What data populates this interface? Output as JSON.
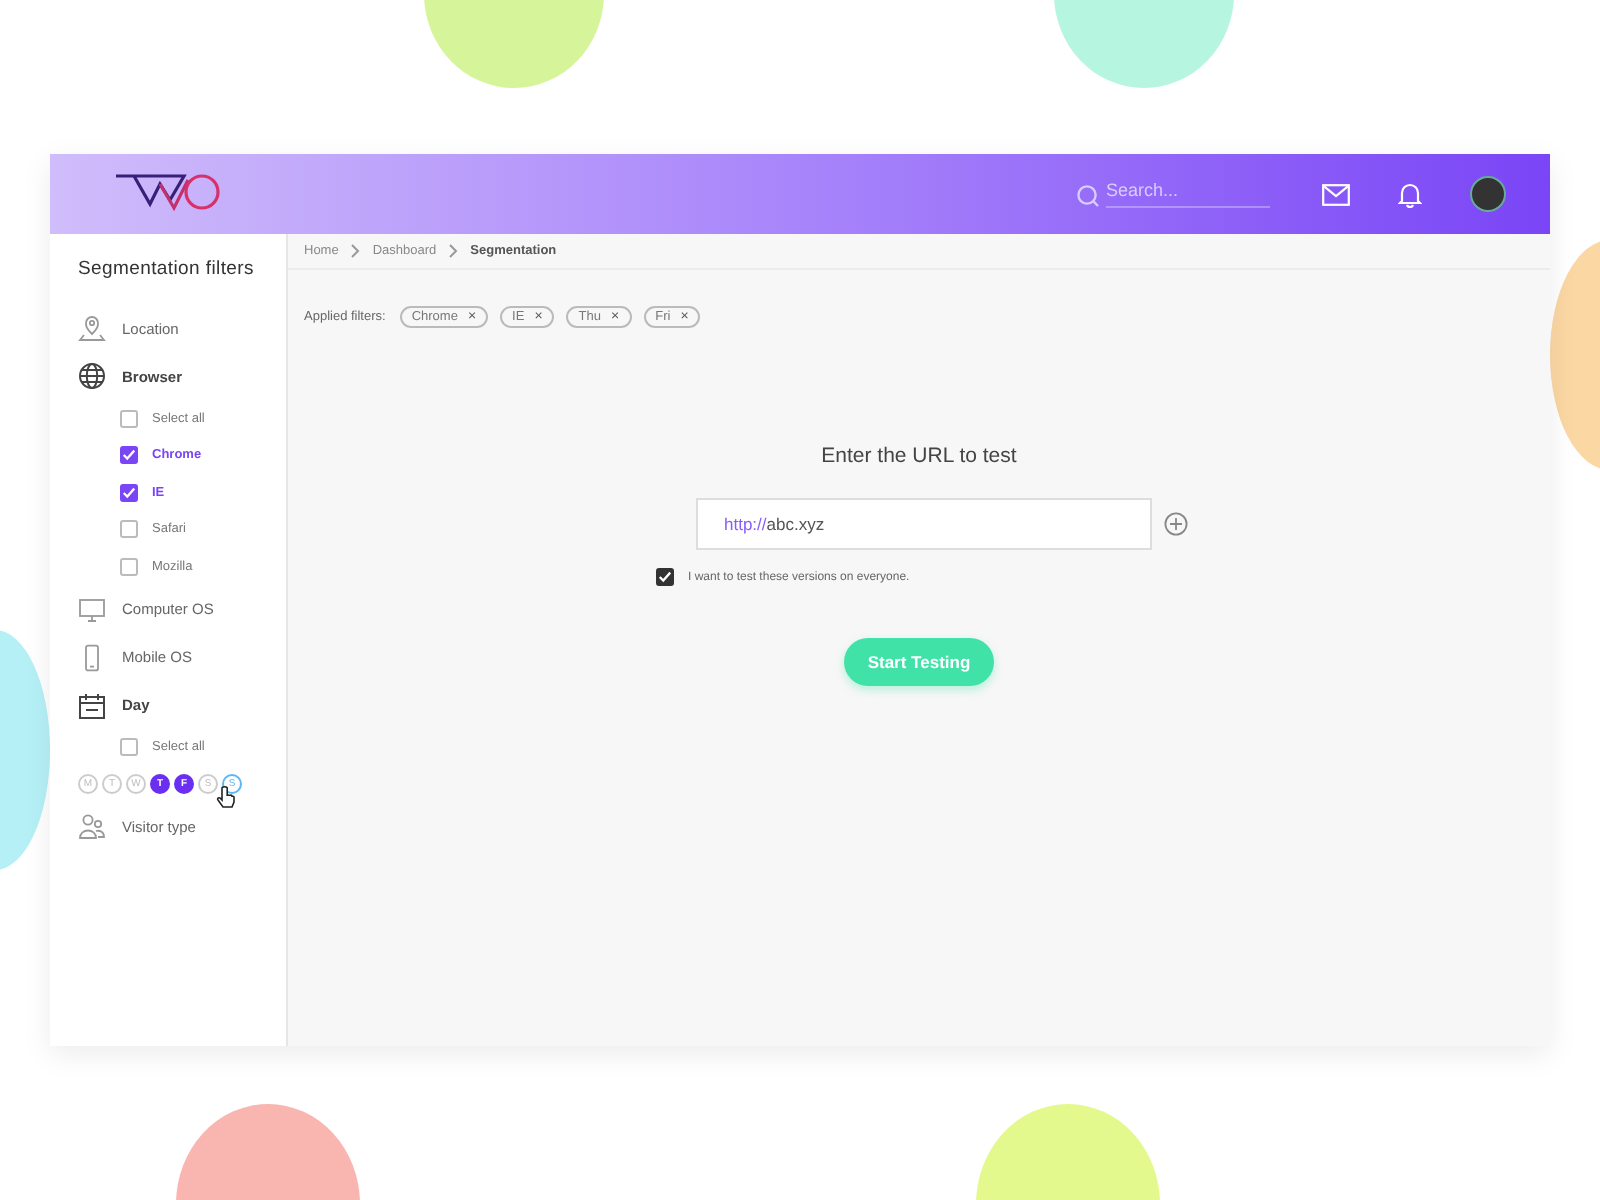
{
  "header": {
    "search": {
      "placeholder": "Search..."
    }
  },
  "sidebar": {
    "title": "Segmentation filters",
    "sections": [
      {
        "label": "Location",
        "expanded": false
      },
      {
        "label": "Browser",
        "expanded": true,
        "options": [
          {
            "label": "Select all",
            "checked": false
          },
          {
            "label": "Chrome",
            "checked": true
          },
          {
            "label": "IE",
            "checked": true
          },
          {
            "label": "Safari",
            "checked": false
          },
          {
            "label": "Mozilla",
            "checked": false
          }
        ]
      },
      {
        "label": "Computer OS",
        "expanded": false
      },
      {
        "label": "Mobile OS",
        "expanded": false
      },
      {
        "label": "Day",
        "expanded": true,
        "options": [
          {
            "label": "Select all",
            "checked": false
          }
        ],
        "days": [
          {
            "label": "M",
            "selected": false,
            "hovered": false
          },
          {
            "label": "T",
            "selected": false,
            "hovered": false
          },
          {
            "label": "W",
            "selected": false,
            "hovered": false
          },
          {
            "label": "T",
            "selected": true,
            "hovered": false
          },
          {
            "label": "F",
            "selected": true,
            "hovered": false
          },
          {
            "label": "S",
            "selected": false,
            "hovered": false
          },
          {
            "label": "S",
            "selected": false,
            "hovered": true
          }
        ]
      },
      {
        "label": "Visitor type",
        "expanded": false
      }
    ]
  },
  "breadcrumb": [
    "Home",
    "Dashboard",
    "Segmentation"
  ],
  "filters": {
    "label": "Applied filters:",
    "chips": [
      "Chrome",
      "IE",
      "Thu",
      "Fri"
    ],
    "remove": "×"
  },
  "url_form": {
    "heading": "Enter the URL to test",
    "prefix": "http://",
    "value": "abc.xyz",
    "consent": {
      "label": "I want to test these versions on everyone.",
      "checked": true
    },
    "button": "Start Testing"
  }
}
